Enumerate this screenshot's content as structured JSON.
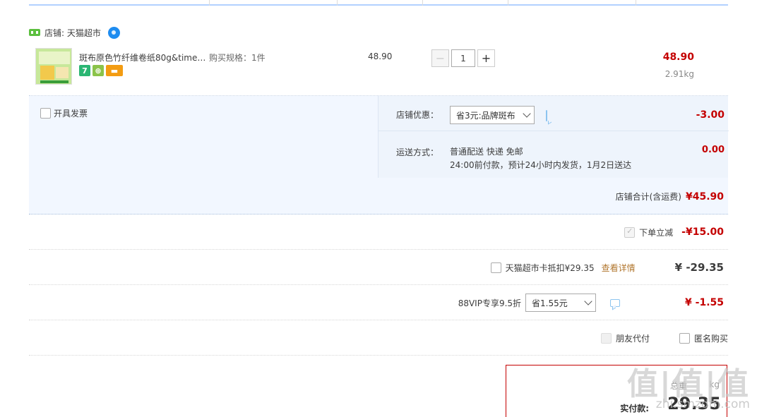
{
  "shop": {
    "label": "店铺: 天猫超市"
  },
  "item": {
    "title": "斑布原色竹纤维卷纸80g&times;...",
    "spec": "购买规格：1件",
    "unit_price": "48.90",
    "quantity": "1",
    "minus": "−",
    "plus": "+",
    "subtotal": "48.90",
    "weight": "2.91kg",
    "badge_seven": "7"
  },
  "invoice": {
    "label": "开具发票"
  },
  "promo": {
    "label": "店铺优惠：",
    "selected": "省3元:品牌斑布",
    "amount": "-3.00"
  },
  "shipping": {
    "label": "运送方式：",
    "method": "普通配送 快递 免邮",
    "note": "24:00前付款，预计24小时内发货，1月2日送达",
    "amount": "0.00"
  },
  "shop_total": {
    "label": "店铺合计(含运费)",
    "value": "¥45.90"
  },
  "discount": {
    "label": "下单立减",
    "value": "-¥15.00"
  },
  "card": {
    "label": "天猫超市卡抵扣¥29.35",
    "link": "查看详情",
    "value": "¥ -29.35"
  },
  "vip": {
    "label": "88VIP专享9.5折",
    "selected": "省1.55元",
    "value": "¥ -1.55"
  },
  "options": {
    "friend_pay": "朋友代付",
    "anonymous": "匿名购买"
  },
  "payment": {
    "label": "实付款:",
    "amount": "29.35",
    "weight_label": "总重",
    "weight": "kg"
  },
  "watermark": {
    "text": "值|值|值",
    "url": "zhi.smzdm.com"
  }
}
